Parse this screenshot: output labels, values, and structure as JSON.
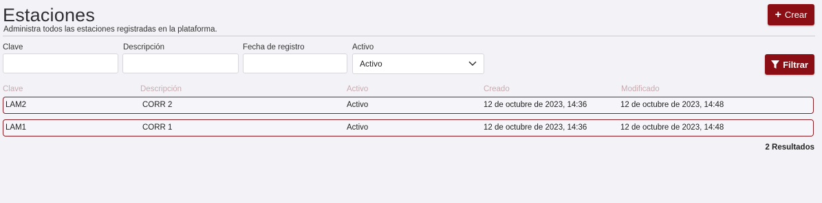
{
  "header": {
    "title": "Estaciones",
    "subtitle": "Administra todos las estaciones registradas en la plataforma.",
    "create_label": "Crear",
    "create_icon": "plus-icon"
  },
  "filters": {
    "clave_label": "Clave",
    "clave_value": "",
    "descripcion_label": "Descripción",
    "descripcion_value": "",
    "fecha_label": "Fecha de registro",
    "fecha_value": "",
    "activo_label": "Activo",
    "activo_selected": "Activo",
    "filter_label": "Filtrar",
    "filter_icon": "funnel-icon"
  },
  "table": {
    "headers": [
      "Clave",
      "Descripción",
      "Activo",
      "Creado",
      "Modificado"
    ],
    "rows": [
      [
        "LAM2",
        "CORR 2",
        "Activo",
        "12 de octubre de 2023, 14:36",
        "12 de octubre de 2023, 14:48"
      ],
      [
        "LAM1",
        "CORR 1",
        "Activo",
        "12 de octubre de 2023, 14:36",
        "12 de octubre de 2023, 14:48"
      ]
    ]
  },
  "results_text": "2 Resultados",
  "colors": {
    "accent": "#8b0e14",
    "background": "#f3f3f7",
    "header_text": "#c8aab0"
  }
}
